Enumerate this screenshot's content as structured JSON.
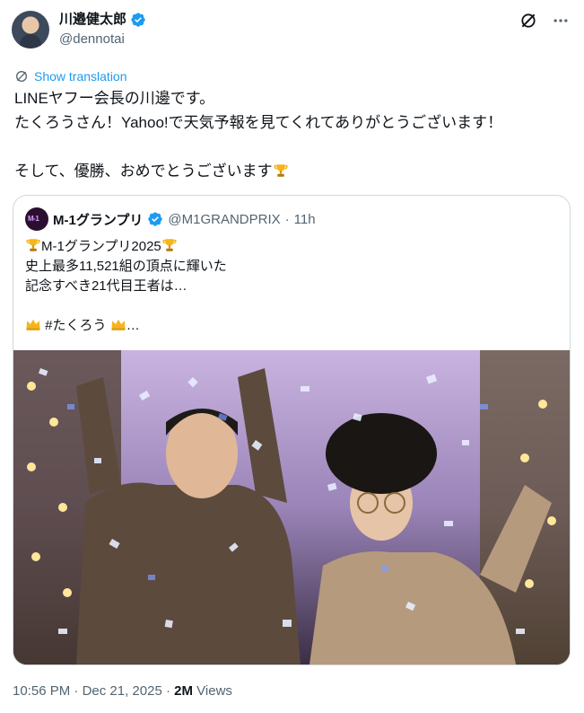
{
  "author": {
    "display_name": "川邉健太郎",
    "handle": "@dennotai",
    "verified": true,
    "avatar": "avatar"
  },
  "header_icons": [
    "grok-icon",
    "more-icon"
  ],
  "translate": {
    "label": "Show translation",
    "icon": "translate-icon"
  },
  "tweet": {
    "text": "LINEヤフー会長の川邊です。\nたくろうさん！Yahoo!で天気予報を見てくれてありがとうございます！\n\nそして、優勝、おめでとうございます",
    "trailing_emoji": "trophy-icon"
  },
  "quote": {
    "display_name": "M-1グランプリ",
    "handle": "@M1GRANDPRIX",
    "separator": "·",
    "time": "11h",
    "avatar_text": "M-1",
    "line1": "M-1グランプリ2025",
    "line2": "史上最多11,521組の頂点に輝いた\n記念すべき21代目王者は…",
    "line3": "#たくろう",
    "line3_suffix": "…"
  },
  "footer": {
    "time": "10:56 PM",
    "separator": "·",
    "date": "Dec 21, 2025",
    "separator2": "·",
    "views_count": "2M",
    "views_label": "Views"
  },
  "colors": {
    "accent": "#1d9bf0",
    "secondary_text": "#536471",
    "border": "#cfd9de"
  }
}
